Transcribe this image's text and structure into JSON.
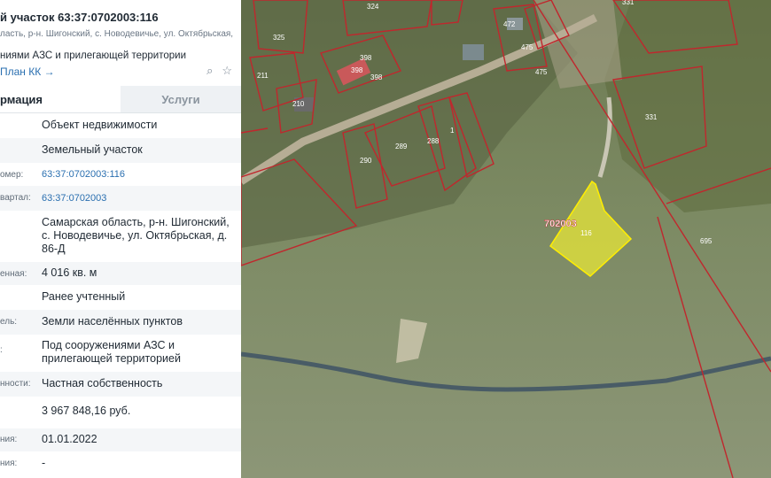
{
  "panel": {
    "title": "й участок 63:37:0702003:116",
    "address_line": "ласть, р-н. Шигонский, с. Новодевичье, ул. Октябрьская,",
    "purpose_line": "ниями АЗС и прилегающей территории",
    "plan_link": "План КК →",
    "tabs": [
      {
        "label": "рмация",
        "active": true
      },
      {
        "label": "Услуги",
        "active": false
      }
    ],
    "rows": [
      {
        "label": "",
        "value": "Объект недвижимости"
      },
      {
        "label": "",
        "value": "Земельный участок"
      },
      {
        "label": "омер:",
        "value": "63:37:0702003:116",
        "link": true
      },
      {
        "label": "вартал:",
        "value": "63:37:0702003",
        "link": true
      },
      {
        "label": "",
        "value": "Самарская область, р-н. Шигонский, с. Новодевичье, ул. Октябрьская, д. 86-Д"
      },
      {
        "label": "енная:",
        "value": "4 016 кв. м"
      },
      {
        "label": "",
        "value": "Ранее учтенный"
      },
      {
        "label": "ель:",
        "value": "Земли населённых пунктов"
      },
      {
        "label": ":",
        "value": "Под сооружениями АЗС и прилегающей территорией"
      },
      {
        "label": "нности:",
        "value": "Частная собственность"
      },
      {
        "label": "",
        "value": "3 967 848,16 руб."
      },
      {
        "label": "ния:",
        "value": "01.01.2022"
      },
      {
        "label": "ния:",
        "value": "-"
      }
    ]
  },
  "map": {
    "selected_parcel_label": "116",
    "block_label": "702003",
    "highlight_color": "#e3e33a",
    "boundary_color": "#c0272d",
    "parcel_labels": [
      "331",
      "324",
      "325",
      "211",
      "210",
      "398",
      "398",
      "472",
      "475",
      "475",
      "331",
      "289",
      "288",
      "1",
      "290",
      "695",
      "398",
      "116"
    ]
  }
}
